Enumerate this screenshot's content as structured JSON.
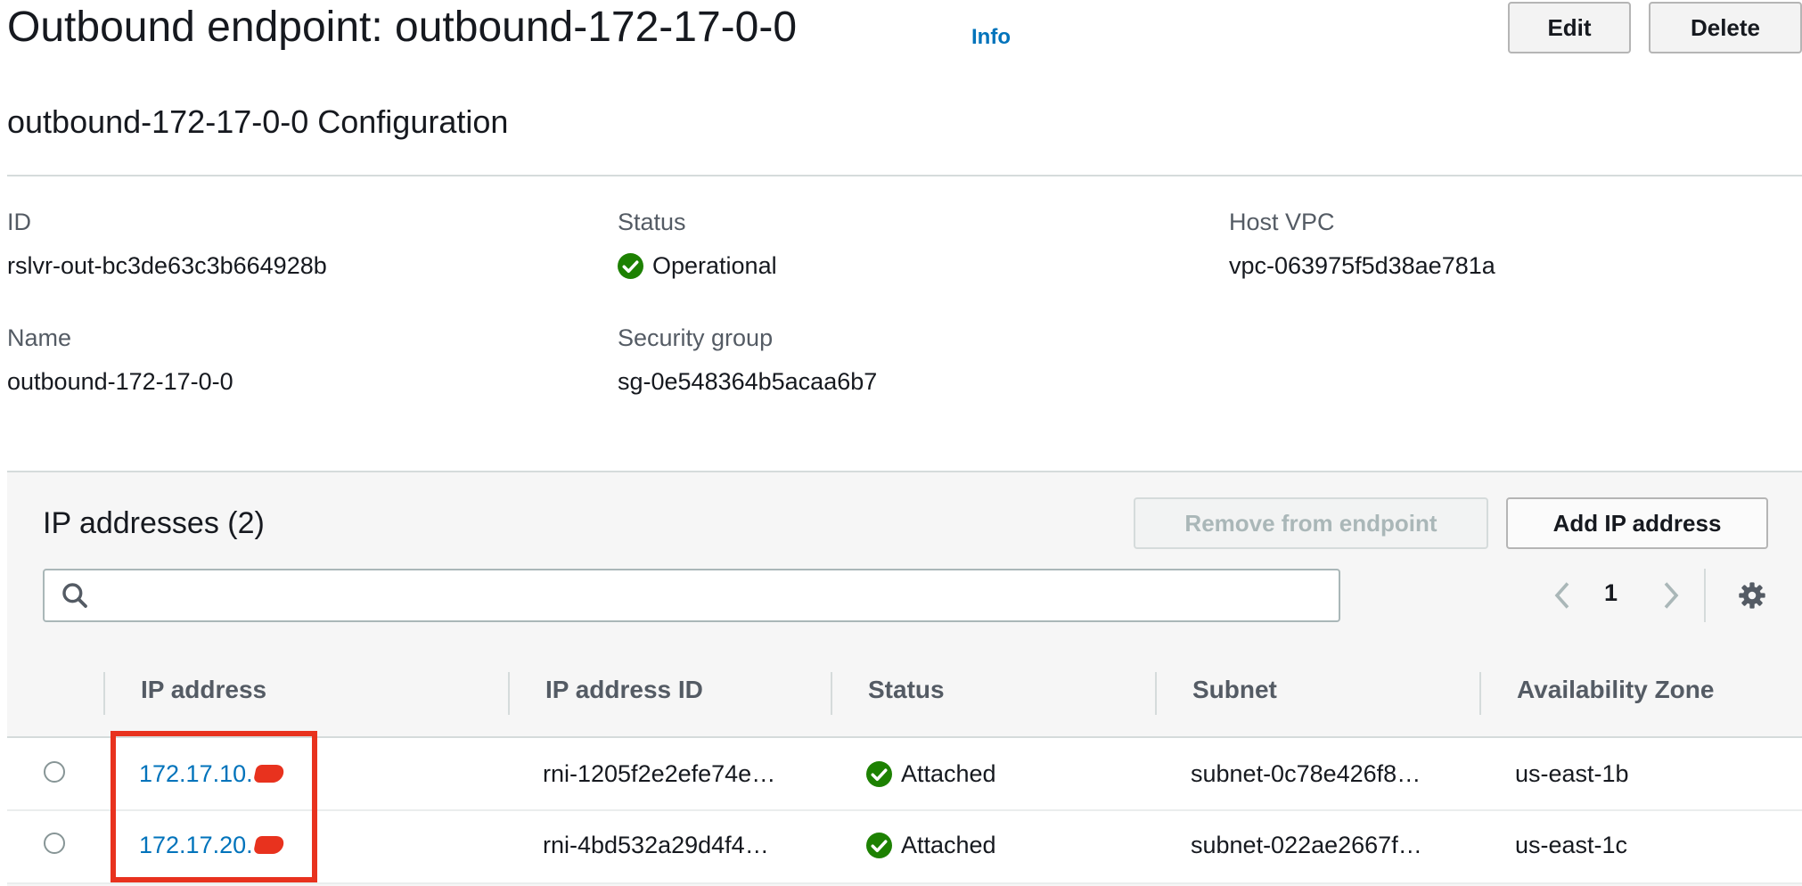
{
  "header": {
    "title": "Outbound endpoint: outbound-172-17-0-0",
    "info_link": "Info",
    "edit_label": "Edit",
    "delete_label": "Delete"
  },
  "config": {
    "section_title": "outbound-172-17-0-0 Configuration",
    "fields": {
      "id": {
        "label": "ID",
        "value": "rslvr-out-bc3de63c3b664928b"
      },
      "status": {
        "label": "Status",
        "value": "Operational",
        "icon": "check-circle-icon"
      },
      "host_vpc": {
        "label": "Host VPC",
        "value": "vpc-063975f5d38ae781a"
      },
      "name": {
        "label": "Name",
        "value": "outbound-172-17-0-0"
      },
      "security_group": {
        "label": "Security group",
        "value": "sg-0e548364b5acaa6b7"
      }
    }
  },
  "ip_table": {
    "title": "IP addresses (2)",
    "remove_label": "Remove from endpoint",
    "add_label": "Add IP address",
    "search": {
      "placeholder": "",
      "value": ""
    },
    "pagination": {
      "current_page": "1"
    },
    "columns": [
      "IP address",
      "IP address ID",
      "Status",
      "Subnet",
      "Availability Zone"
    ],
    "rows": [
      {
        "ip": "172.17.10.",
        "ip_id": "rni-1205f2e2efe74e…",
        "status": "Attached",
        "subnet": "subnet-0c78e426f8…",
        "az": "us-east-1b"
      },
      {
        "ip": "172.17.20.",
        "ip_id": "rni-4bd532a29d4f4…",
        "status": "Attached",
        "subnet": "subnet-022ae2667f…",
        "az": "us-east-1c"
      }
    ]
  },
  "colors": {
    "link": "#0073bb",
    "success": "#1d8102",
    "annotation": "#e8321e"
  }
}
